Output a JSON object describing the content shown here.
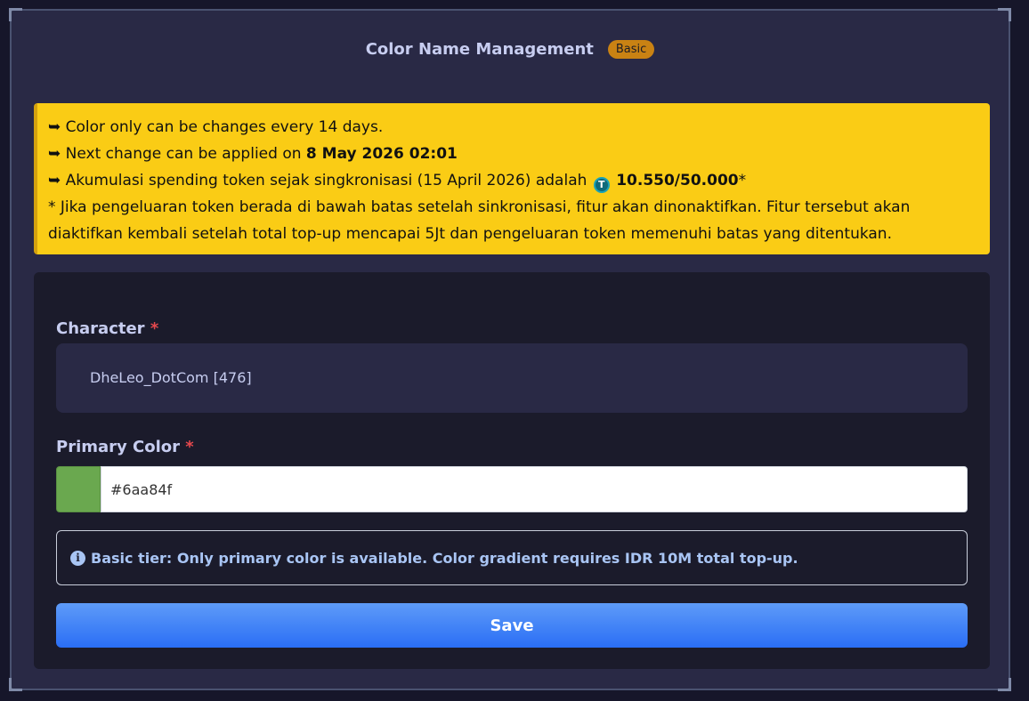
{
  "header": {
    "title": "Color Name Management",
    "badge": "Basic"
  },
  "notice": {
    "arrow": "➥",
    "line1": "Color only can be changes every 14 days.",
    "line2_prefix": "Next change can be applied on ",
    "line2_date": "8 May 2026 02:01",
    "line3_prefix": "Akumulasi spending token sejak singkronisasi (15 April 2026) adalah",
    "token_icon": "T",
    "line3_value": "10.550/50.000",
    "line3_suffix": "*",
    "footnote": "* Jika pengeluaran token berada di bawah batas setelah sinkronisasi, fitur akan dinonaktifkan. Fitur tersebut akan diaktifkan kembali setelah total top-up mencapai 5Jt dan pengeluaran token memenuhi batas yang ditentukan."
  },
  "form": {
    "character_label": "Character",
    "required_mark": "*",
    "character_value": "DheLeo_DotCom [476]",
    "primary_color_label": "Primary Color",
    "primary_color_value": "#6aa84f",
    "info_icon": "i",
    "info_text": "Basic tier: Only primary color is available. Color gradient requires IDR 10M total top-up.",
    "save_label": "Save"
  },
  "colors": {
    "background": "#292945",
    "notice": "#facc15",
    "badge": "#c98213",
    "swatch": "#6aa84f",
    "save_button": "#3b82f6"
  }
}
